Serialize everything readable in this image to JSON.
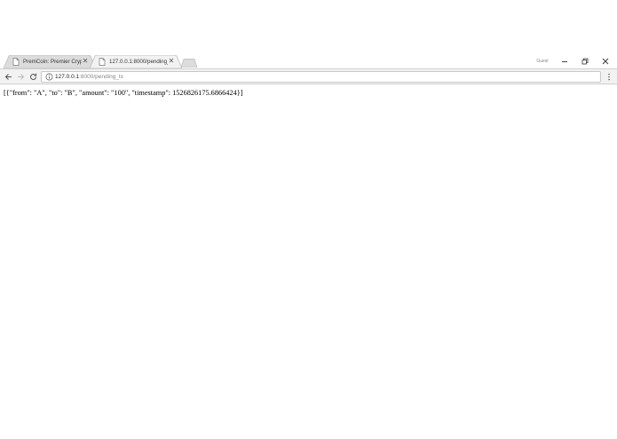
{
  "browser": {
    "tabs": [
      {
        "title": "PremCoin: Premier Crypto",
        "active": false
      },
      {
        "title": "127.0.0.1:8000/pending_tx",
        "active": true
      }
    ],
    "profile_label": "Guest",
    "address_bar": {
      "host": "127.0.0.1",
      "path": ":8000/pending_tx"
    }
  },
  "page": {
    "body_text": "[{\"from\": \"A\", \"to\": \"B\", \"amount\": \"100\", \"timestamp\": 1526826175.6866424}]"
  },
  "colors": {
    "tabstrip_bg": "#ffffff",
    "toolbar_bg": "#f2f2f2",
    "inactive_tab": "#dcdcdc",
    "active_tab": "#f2f2f2"
  }
}
